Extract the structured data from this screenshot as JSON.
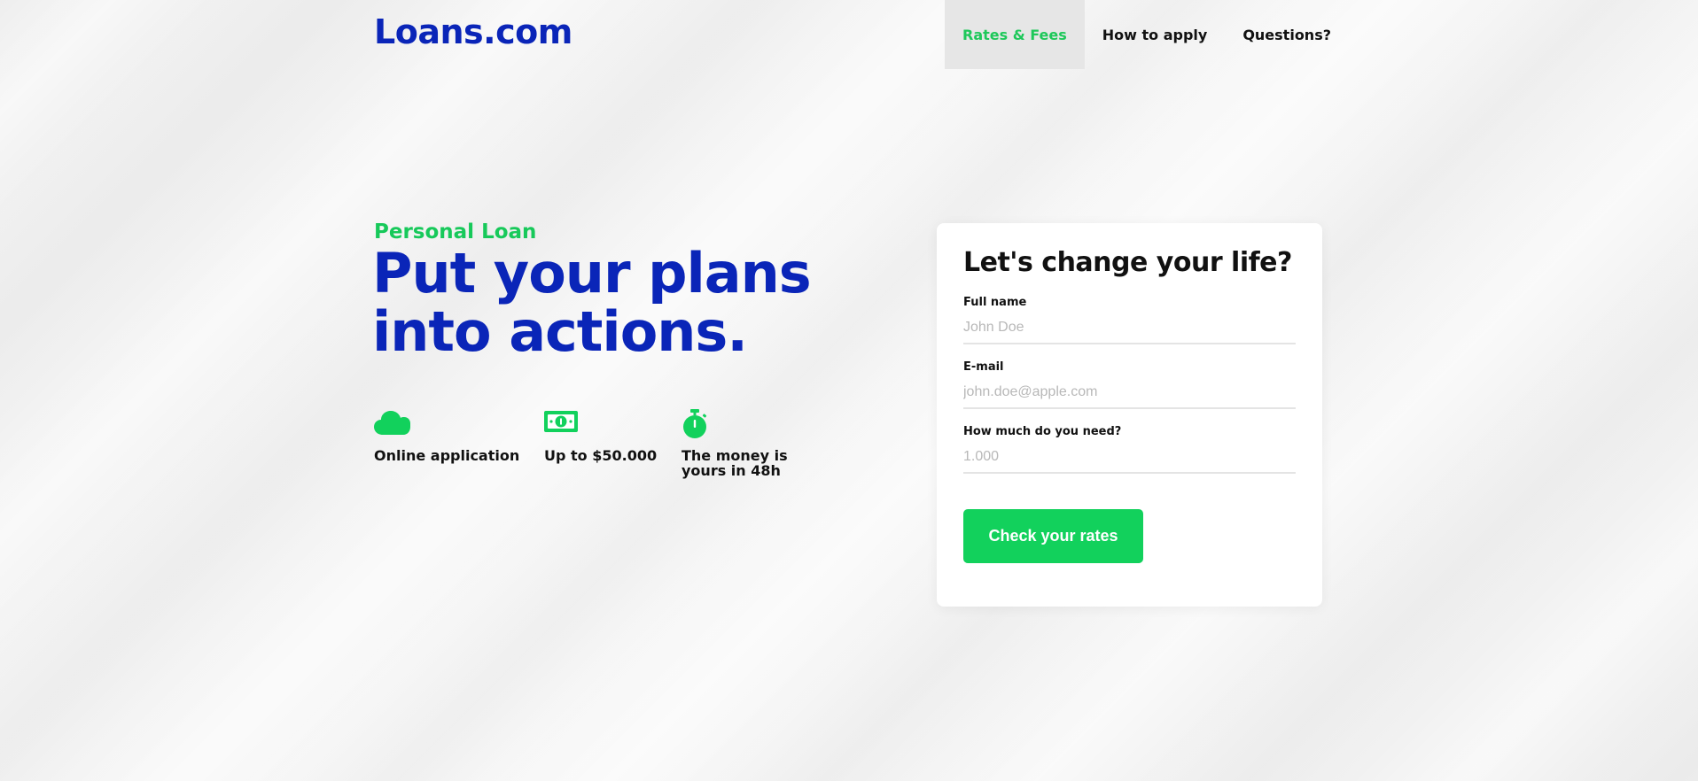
{
  "brand": {
    "logo": "Loans.com",
    "primary_color": "#0a25b8",
    "accent_color": "#12d15c"
  },
  "nav": {
    "items": [
      {
        "label": "Rates & Fees",
        "active": true
      },
      {
        "label": "How to apply",
        "active": false
      },
      {
        "label": "Questions?",
        "active": false
      }
    ]
  },
  "hero": {
    "eyebrow": "Personal Loan",
    "headline": "Put your plans into actions.",
    "features": [
      {
        "icon": "cloud-icon",
        "label": "Online application"
      },
      {
        "icon": "money-bill-icon",
        "label": "Up to $50.000"
      },
      {
        "icon": "stopwatch-icon",
        "label": "The money is yours in 48h"
      }
    ]
  },
  "form": {
    "title": "Let's change your life?",
    "fields": [
      {
        "label": "Full name",
        "value": "",
        "placeholder": "John Doe"
      },
      {
        "label": "E-mail",
        "value": "",
        "placeholder": "john.doe@apple.com"
      },
      {
        "label": "How much do you need?",
        "value": "",
        "placeholder": "1.000"
      }
    ],
    "submit_label": "Check your rates"
  }
}
